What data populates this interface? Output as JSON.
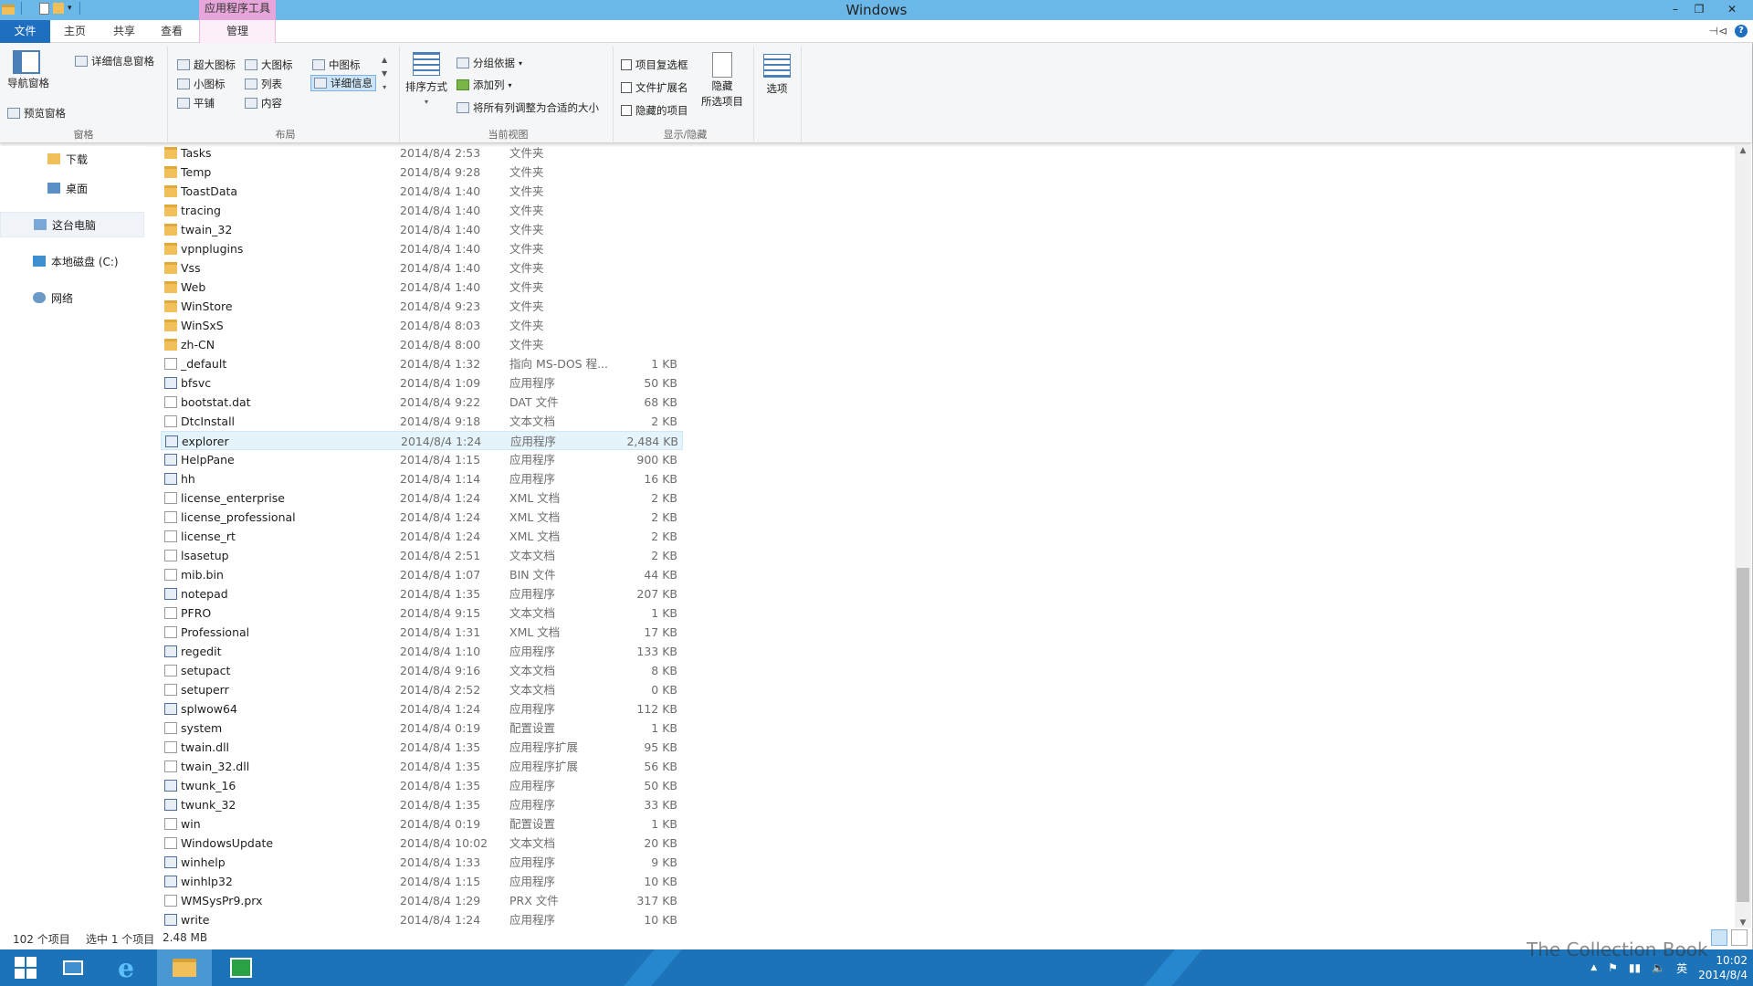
{
  "window": {
    "title": "Windows",
    "app_tools_label": "应用程序工具",
    "controls": {
      "minimize": "–",
      "maximize": "❐",
      "close": "✕"
    }
  },
  "tabs": {
    "file": "文件",
    "home": "主页",
    "share": "共享",
    "view": "查看",
    "manage": "管理"
  },
  "ribbon": {
    "pane": {
      "nav_pane": "导航窗格",
      "preview_pane": "预览窗格",
      "details_pane": "详细信息窗格",
      "label": "窗格"
    },
    "layout": {
      "extra_large": "超大图标",
      "large": "大图标",
      "medium": "中图标",
      "small": "小图标",
      "list": "列表",
      "details": "详细信息",
      "tiles": "平铺",
      "content": "内容",
      "label": "布局"
    },
    "current_view": {
      "sort_by": "排序方式",
      "group_by": "分组依据",
      "add_columns": "添加列",
      "size_all_columns": "将所有列调整为合适的大小",
      "label": "当前视图"
    },
    "show_hide": {
      "item_checkboxes": "项目复选框",
      "file_extensions": "文件扩展名",
      "hidden_items": "隐藏的项目",
      "hide_selected_line1": "隐藏",
      "hide_selected_line2": "所选项目",
      "label": "显示/隐藏"
    },
    "options": "选项"
  },
  "nav": {
    "items": [
      {
        "label": "下载"
      },
      {
        "label": "桌面"
      },
      {
        "label": "这台电脑"
      },
      {
        "label": "本地磁盘 (C:)"
      },
      {
        "label": "网络"
      }
    ]
  },
  "files": [
    {
      "name": "Tasks",
      "date": "2014/8/4 2:53",
      "type": "文件夹",
      "size": "",
      "kind": "folder"
    },
    {
      "name": "Temp",
      "date": "2014/8/4 9:28",
      "type": "文件夹",
      "size": "",
      "kind": "folder"
    },
    {
      "name": "ToastData",
      "date": "2014/8/4 1:40",
      "type": "文件夹",
      "size": "",
      "kind": "folder"
    },
    {
      "name": "tracing",
      "date": "2014/8/4 1:40",
      "type": "文件夹",
      "size": "",
      "kind": "folder"
    },
    {
      "name": "twain_32",
      "date": "2014/8/4 1:40",
      "type": "文件夹",
      "size": "",
      "kind": "folder"
    },
    {
      "name": "vpnplugins",
      "date": "2014/8/4 1:40",
      "type": "文件夹",
      "size": "",
      "kind": "folder"
    },
    {
      "name": "Vss",
      "date": "2014/8/4 1:40",
      "type": "文件夹",
      "size": "",
      "kind": "folder"
    },
    {
      "name": "Web",
      "date": "2014/8/4 1:40",
      "type": "文件夹",
      "size": "",
      "kind": "folder"
    },
    {
      "name": "WinStore",
      "date": "2014/8/4 9:23",
      "type": "文件夹",
      "size": "",
      "kind": "folder"
    },
    {
      "name": "WinSxS",
      "date": "2014/8/4 8:03",
      "type": "文件夹",
      "size": "",
      "kind": "folder"
    },
    {
      "name": "zh-CN",
      "date": "2014/8/4 8:00",
      "type": "文件夹",
      "size": "",
      "kind": "folder"
    },
    {
      "name": "_default",
      "date": "2014/8/4 1:32",
      "type": "指向 MS-DOS 程...",
      "size": "1 KB",
      "kind": "doc"
    },
    {
      "name": "bfsvc",
      "date": "2014/8/4 1:09",
      "type": "应用程序",
      "size": "50 KB",
      "kind": "exe"
    },
    {
      "name": "bootstat.dat",
      "date": "2014/8/4 9:22",
      "type": "DAT 文件",
      "size": "68 KB",
      "kind": "doc"
    },
    {
      "name": "DtcInstall",
      "date": "2014/8/4 9:18",
      "type": "文本文档",
      "size": "2 KB",
      "kind": "doc"
    },
    {
      "name": "explorer",
      "date": "2014/8/4 1:24",
      "type": "应用程序",
      "size": "2,484 KB",
      "kind": "exe"
    },
    {
      "name": "HelpPane",
      "date": "2014/8/4 1:15",
      "type": "应用程序",
      "size": "900 KB",
      "kind": "exe"
    },
    {
      "name": "hh",
      "date": "2014/8/4 1:14",
      "type": "应用程序",
      "size": "16 KB",
      "kind": "exe"
    },
    {
      "name": "license_enterprise",
      "date": "2014/8/4 1:24",
      "type": "XML 文档",
      "size": "2 KB",
      "kind": "doc"
    },
    {
      "name": "license_professional",
      "date": "2014/8/4 1:24",
      "type": "XML 文档",
      "size": "2 KB",
      "kind": "doc"
    },
    {
      "name": "license_rt",
      "date": "2014/8/4 1:24",
      "type": "XML 文档",
      "size": "2 KB",
      "kind": "doc"
    },
    {
      "name": "lsasetup",
      "date": "2014/8/4 2:51",
      "type": "文本文档",
      "size": "2 KB",
      "kind": "doc"
    },
    {
      "name": "mib.bin",
      "date": "2014/8/4 1:07",
      "type": "BIN 文件",
      "size": "44 KB",
      "kind": "doc"
    },
    {
      "name": "notepad",
      "date": "2014/8/4 1:35",
      "type": "应用程序",
      "size": "207 KB",
      "kind": "exe"
    },
    {
      "name": "PFRO",
      "date": "2014/8/4 9:15",
      "type": "文本文档",
      "size": "1 KB",
      "kind": "doc"
    },
    {
      "name": "Professional",
      "date": "2014/8/4 1:31",
      "type": "XML 文档",
      "size": "17 KB",
      "kind": "doc"
    },
    {
      "name": "regedit",
      "date": "2014/8/4 1:10",
      "type": "应用程序",
      "size": "133 KB",
      "kind": "exe"
    },
    {
      "name": "setupact",
      "date": "2014/8/4 9:16",
      "type": "文本文档",
      "size": "8 KB",
      "kind": "doc"
    },
    {
      "name": "setuperr",
      "date": "2014/8/4 2:52",
      "type": "文本文档",
      "size": "0 KB",
      "kind": "doc"
    },
    {
      "name": "splwow64",
      "date": "2014/8/4 1:24",
      "type": "应用程序",
      "size": "112 KB",
      "kind": "exe"
    },
    {
      "name": "system",
      "date": "2014/8/4 0:19",
      "type": "配置设置",
      "size": "1 KB",
      "kind": "doc"
    },
    {
      "name": "twain.dll",
      "date": "2014/8/4 1:35",
      "type": "应用程序扩展",
      "size": "95 KB",
      "kind": "doc"
    },
    {
      "name": "twain_32.dll",
      "date": "2014/8/4 1:35",
      "type": "应用程序扩展",
      "size": "56 KB",
      "kind": "doc"
    },
    {
      "name": "twunk_16",
      "date": "2014/8/4 1:35",
      "type": "应用程序",
      "size": "50 KB",
      "kind": "exe"
    },
    {
      "name": "twunk_32",
      "date": "2014/8/4 1:35",
      "type": "应用程序",
      "size": "33 KB",
      "kind": "exe"
    },
    {
      "name": "win",
      "date": "2014/8/4 0:19",
      "type": "配置设置",
      "size": "1 KB",
      "kind": "doc"
    },
    {
      "name": "WindowsUpdate",
      "date": "2014/8/4 10:02",
      "type": "文本文档",
      "size": "20 KB",
      "kind": "doc"
    },
    {
      "name": "winhelp",
      "date": "2014/8/4 1:33",
      "type": "应用程序",
      "size": "9 KB",
      "kind": "exe"
    },
    {
      "name": "winhlp32",
      "date": "2014/8/4 1:15",
      "type": "应用程序",
      "size": "10 KB",
      "kind": "exe"
    },
    {
      "name": "WMSysPr9.prx",
      "date": "2014/8/4 1:29",
      "type": "PRX 文件",
      "size": "317 KB",
      "kind": "doc"
    },
    {
      "name": "write",
      "date": "2014/8/4 1:24",
      "type": "应用程序",
      "size": "10 KB",
      "kind": "exe"
    }
  ],
  "selected_file": "explorer",
  "status": {
    "count": "102 个项目",
    "selected": "选中 1 个项目",
    "size": "2.48 MB"
  },
  "taskbar": {
    "ime": "英",
    "time": "10:02",
    "date": "2014/8/4"
  },
  "watermark": "The Collection Book",
  "colors": {
    "titlebar": "#6bb8e8",
    "file_tab": "#1f6fc1",
    "taskbar": "#1c73b8",
    "selected_row": "#e5f3fb"
  }
}
